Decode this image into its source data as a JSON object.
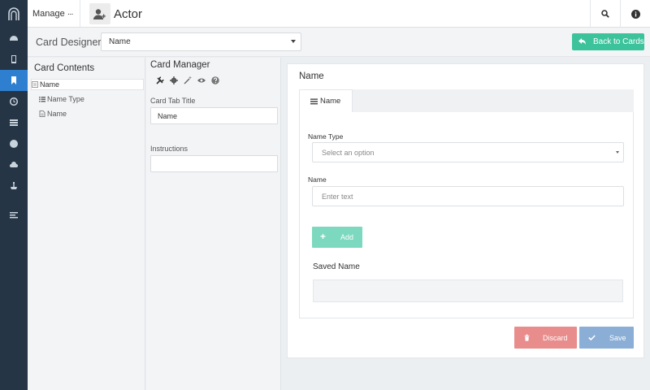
{
  "header": {
    "manage_label": "Manage",
    "manage_more": "···",
    "title": "Actor",
    "actor_icon": "user-plus-icon",
    "search_icon": "search-icon",
    "info_icon": "info-icon"
  },
  "rail": {
    "logo": "arch-logo-icon",
    "items": [
      {
        "icon": "dashboard-icon",
        "active": false
      },
      {
        "icon": "tablet-icon",
        "active": false
      },
      {
        "icon": "bookmark-icon",
        "active": true
      },
      {
        "icon": "clock-icon",
        "active": false
      },
      {
        "icon": "list-icon",
        "active": false
      },
      {
        "icon": "globe-icon",
        "active": false
      },
      {
        "icon": "cloud-upload-icon",
        "active": false
      },
      {
        "icon": "anchor-icon",
        "active": false
      },
      {
        "icon": "align-left-icon",
        "active": false
      }
    ]
  },
  "designer": {
    "label": "Card Designer",
    "select_value": "Name",
    "back_button": "Back to Cards"
  },
  "contents": {
    "title": "Card Contents",
    "items": [
      {
        "label": "Name",
        "icon": "card-icon",
        "selected": true
      },
      {
        "label": "Name Type",
        "icon": "list-icon",
        "selected": false
      },
      {
        "label": "Name",
        "icon": "file-icon",
        "selected": false
      }
    ]
  },
  "manager": {
    "title": "Card Manager",
    "tools": [
      "wrench-icon",
      "gear-icon",
      "magic-wand-icon",
      "eye-icon",
      "help-icon"
    ],
    "tab_title_label": "Card Tab Title",
    "tab_title_value": "Name",
    "instructions_label": "Instructions",
    "instructions_value": ""
  },
  "card": {
    "title": "Name",
    "tab_label": "Name",
    "name_type_label": "Name Type",
    "name_type_placeholder": "Select an option",
    "name_label": "Name",
    "name_placeholder": "Enter text",
    "add_button": "Add",
    "saved_label": "Saved Name",
    "discard_button": "Discard",
    "save_button": "Save"
  },
  "colors": {
    "rail": "#263545",
    "rail_active": "#2f7fd0",
    "primary_green": "#3cc39b",
    "add_green": "#7cd8be",
    "discard_red": "#e88c8c",
    "save_blue": "#8aaed5"
  }
}
